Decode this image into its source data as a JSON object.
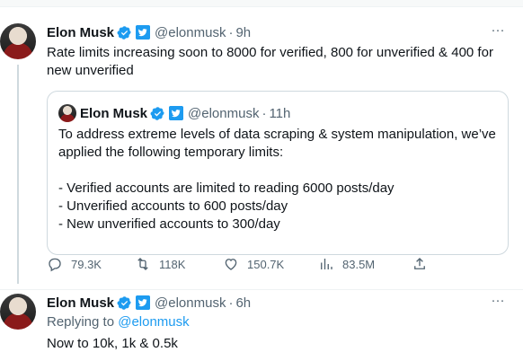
{
  "colors": {
    "accent": "#1d9bf0",
    "text": "#0f1419",
    "muted": "#536471",
    "border": "#cfd9de"
  },
  "tweet1": {
    "avatar_icon": "elon-avatar",
    "author_name": "Elon Musk",
    "handle": "@elonmusk",
    "time": "9h",
    "text": "Rate limits increasing soon to 8000 for verified, 800 for unverified & 400 for new unverified",
    "more_icon": "ellipsis-icon",
    "quote": {
      "author_name": "Elon Musk",
      "handle": "@elonmusk",
      "time": "11h",
      "text": "To address extreme levels of data scraping & system manipulation, we’ve applied the following temporary limits:\n\n- Verified accounts are limited to reading 6000 posts/day\n- Unverified accounts to 600 posts/day\n- New unverified accounts to 300/day"
    },
    "actions": {
      "replies": "79.3K",
      "retweets": "118K",
      "likes": "150.7K",
      "views": "83.5M"
    }
  },
  "tweet2": {
    "author_name": "Elon Musk",
    "handle": "@elonmusk",
    "time": "6h",
    "replying_prefix": "Replying to",
    "replying_handle": "@elonmusk",
    "text": "Now to 10k, 1k & 0.5k"
  }
}
